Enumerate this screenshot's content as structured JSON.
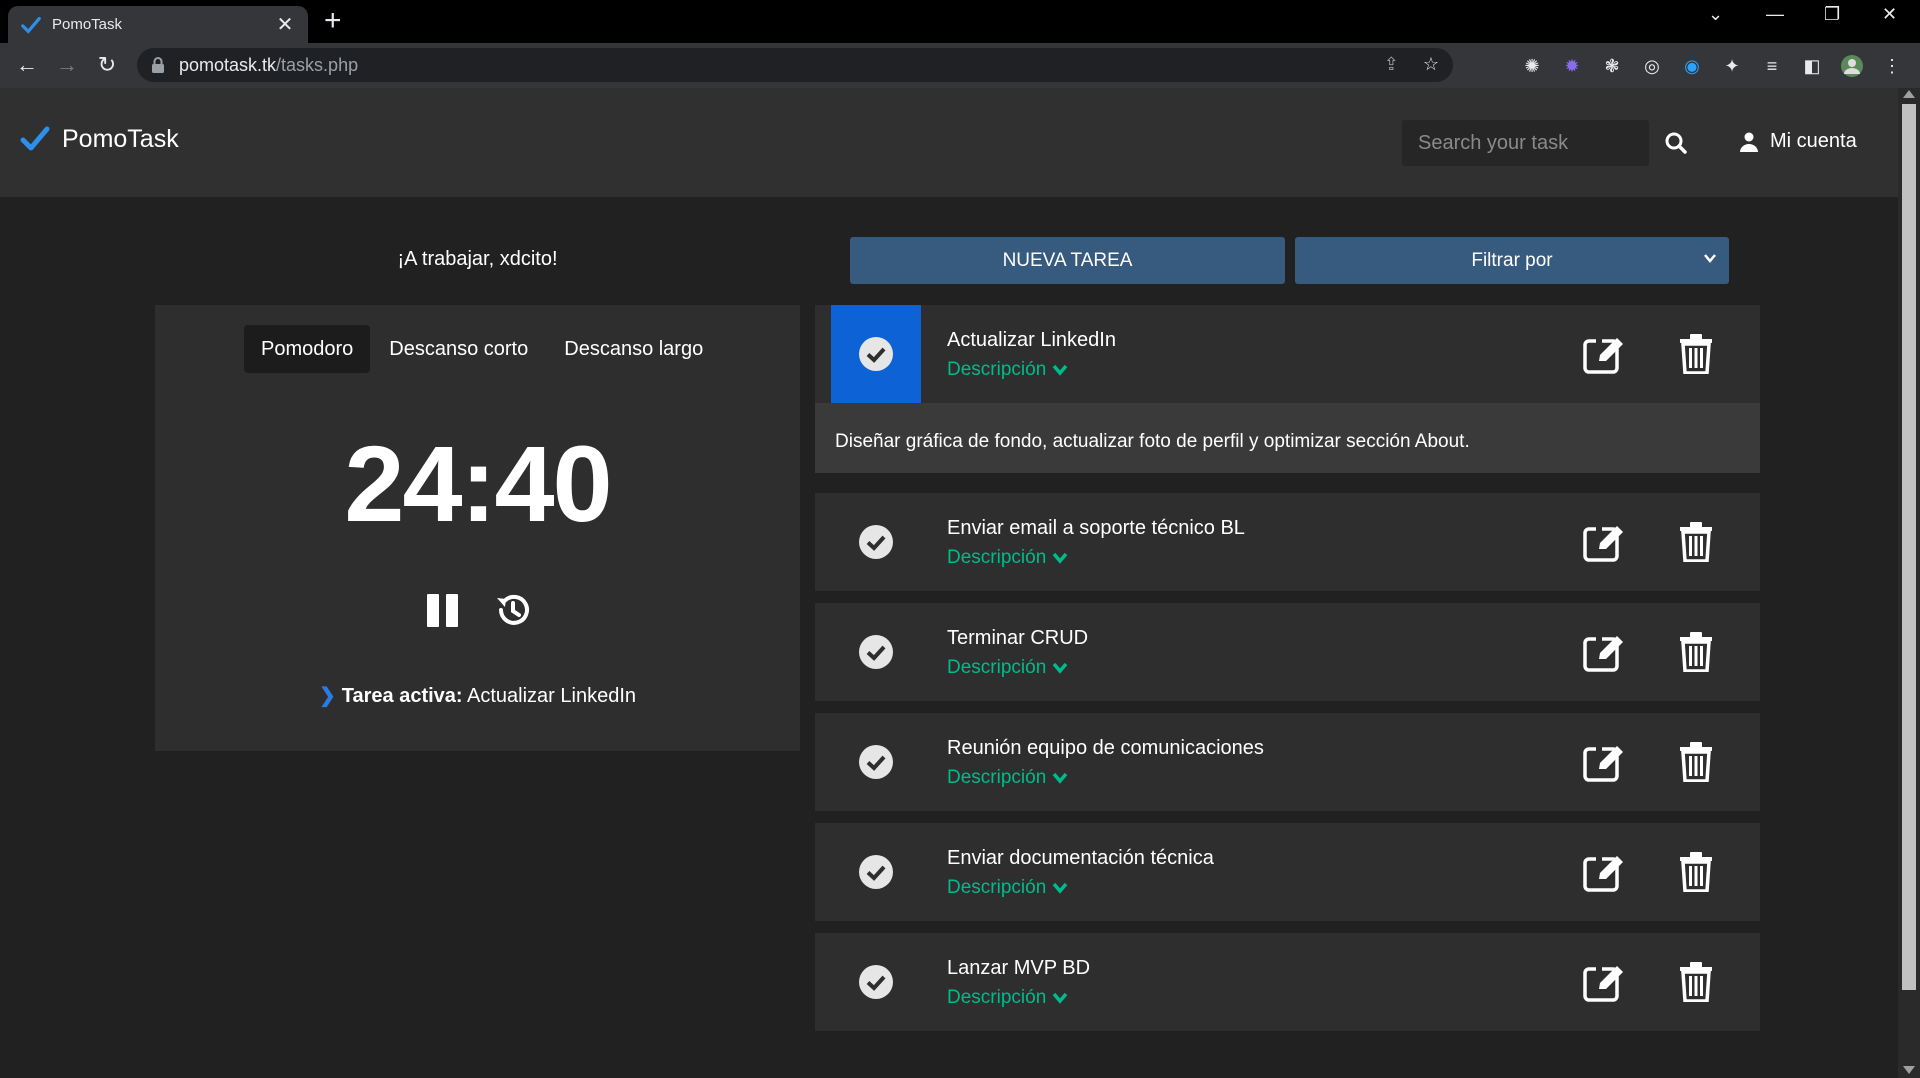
{
  "browser": {
    "tab_title": "PomoTask",
    "url_host": "pomotask.tk",
    "url_path": "/tasks.php",
    "accent": "#1a73e8"
  },
  "header": {
    "brand": "PomoTask",
    "search_placeholder": "Search your task",
    "account_label": "Mi cuenta"
  },
  "greeting": "¡A trabajar, xdcito!",
  "timer": {
    "modes": [
      "Pomodoro",
      "Descanso corto",
      "Descanso largo"
    ],
    "active_mode": "Pomodoro",
    "time": "24:40",
    "active_task_label": "Tarea activa:",
    "active_task_name": "Actualizar LinkedIn"
  },
  "actions": {
    "new_task": "NUEVA TAREA",
    "filter": "Filtrar por"
  },
  "tasks": [
    {
      "title": "Actualizar LinkedIn",
      "desc_label": "Descripción",
      "expanded": true,
      "description": "Diseñar gráfica de fondo, actualizar foto de perfil y optimizar sección About."
    },
    {
      "title": "Enviar email a soporte técnico BL",
      "desc_label": "Descripción",
      "expanded": false
    },
    {
      "title": "Terminar CRUD",
      "desc_label": "Descripción",
      "expanded": false
    },
    {
      "title": "Reunión equipo de comunicaciones",
      "desc_label": "Descripción",
      "expanded": false
    },
    {
      "title": "Enviar documentación técnica",
      "desc_label": "Descripción",
      "expanded": false
    },
    {
      "title": "Lanzar MVP BD",
      "desc_label": "Descripción",
      "expanded": false
    }
  ],
  "colors": {
    "primary": "#375a7f",
    "success": "#00bc8c",
    "active_check": "#0d62d6"
  }
}
